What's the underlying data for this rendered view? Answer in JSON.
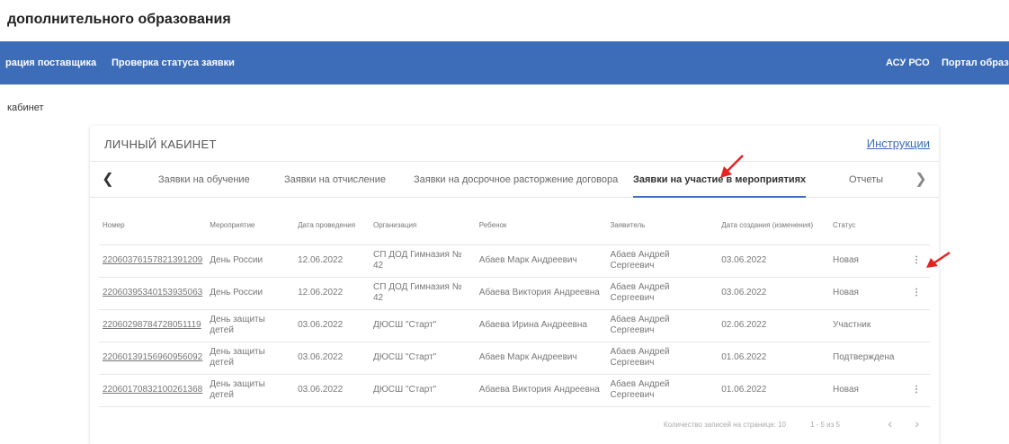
{
  "site": {
    "title": "дополнительного образования"
  },
  "nav": {
    "left": [
      "рация поставщика",
      "Проверка статуса заявки"
    ],
    "right": [
      "АСУ РСО",
      "Портал образоват"
    ]
  },
  "breadcrumb": "кабинет",
  "card": {
    "title": "ЛИЧНЫЙ КАБИНЕТ",
    "instructions": "Инструкции"
  },
  "tabs": {
    "items": [
      "Заявки на обучение",
      "Заявки на отчисление",
      "Заявки на досрочное расторжение договора",
      "Заявки на участие в мероприятиях",
      "Отчеты"
    ],
    "active_index": 3,
    "prev_icon": "chevron-left-icon",
    "next_icon": "chevron-right-icon"
  },
  "table": {
    "headers": [
      "Номер",
      "Мероприятие",
      "Дата проведения",
      "Организация",
      "Ребенок",
      "Заявитель",
      "Дата создания (изменения)",
      "Статус"
    ],
    "rows": [
      [
        "22060376157821391209",
        "День России",
        "12.06.2022",
        "СП ДОД Гимназия № 42",
        "Абаев Марк Андреевич",
        "Абаев Андрей Сергеевич",
        "03.06.2022",
        "Новая"
      ],
      [
        "22060395340153935063",
        "День России",
        "12.06.2022",
        "СП ДОД Гимназия № 42",
        "Абаева Виктория Андреевна",
        "Абаев Андрей Сергеевич",
        "03.06.2022",
        "Новая"
      ],
      [
        "22060298784728051119",
        "День защиты детей",
        "03.06.2022",
        "ДЮСШ \"Старт\"",
        "Абаева Ирина Андреевна",
        "Абаев Андрей Сергеевич",
        "02.06.2022",
        "Участник"
      ],
      [
        "22060139156960956092",
        "День защиты детей",
        "03.06.2022",
        "ДЮСШ \"Старт\"",
        "Абаев Марк Андреевич",
        "Абаев Андрей Сергеевич",
        "01.06.2022",
        "Подтверждена"
      ],
      [
        "22060170832100261368",
        "День защиты детей",
        "03.06.2022",
        "ДЮСШ \"Старт\"",
        "Абаева Виктория Андреевна",
        "Абаев Андрей Сергеевич",
        "01.06.2022",
        "Новая"
      ]
    ],
    "row_menu": [
      true,
      true,
      false,
      false,
      true
    ]
  },
  "footer": {
    "per_page": "Количество записей на странице: 10",
    "range": "1 - 5 из 5"
  },
  "colors": {
    "navbar": "#3d6db8",
    "annotation": "#e52222"
  }
}
